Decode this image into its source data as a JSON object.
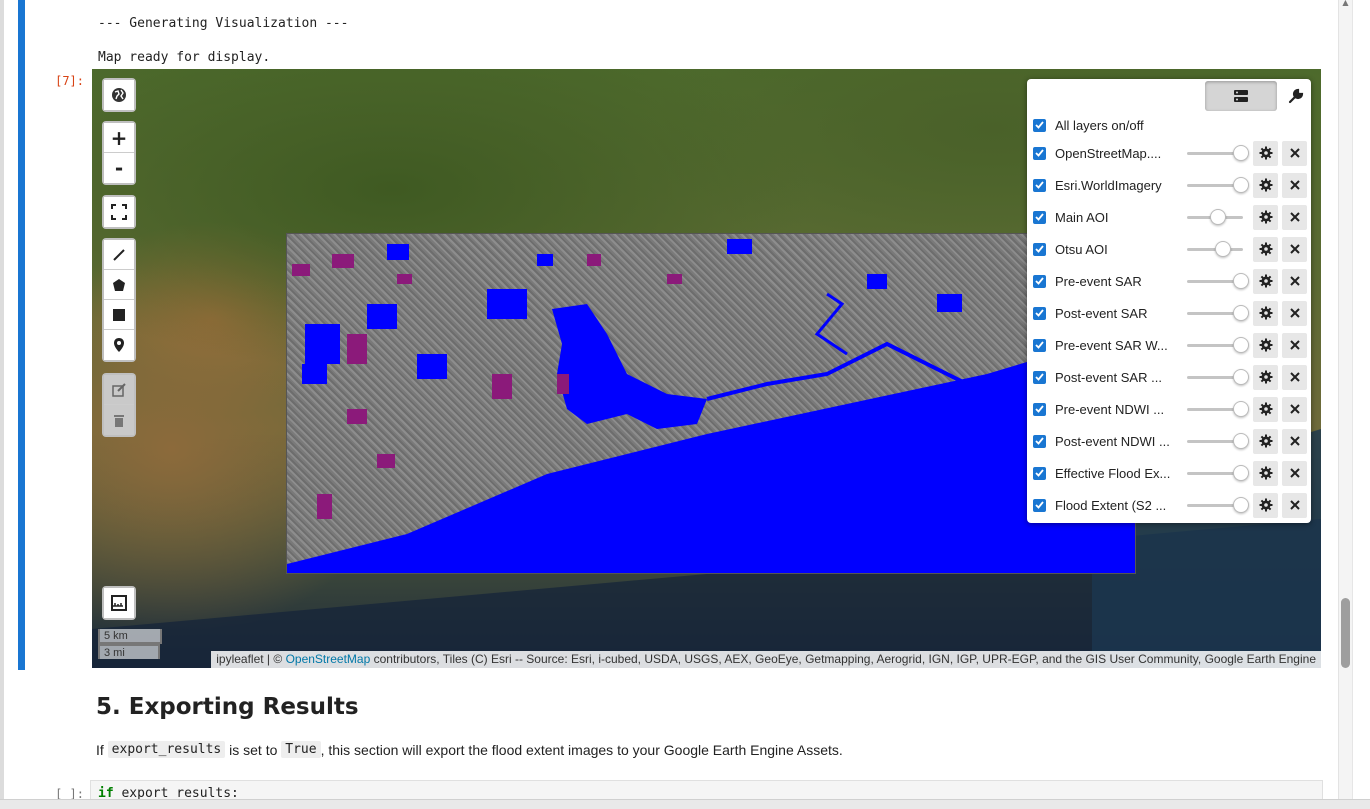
{
  "notebook": {
    "output_line_1": "--- Generating Visualization ---",
    "output_line_2": "Map ready for display.",
    "exec_prompt": "[7]:",
    "empty_prompt": "[ ]:"
  },
  "map": {
    "controls": {
      "zoom_in_label": "+",
      "zoom_out_label": "-"
    },
    "scale": {
      "metric": "5 km",
      "imperial": "3 mi"
    },
    "attribution": {
      "prefix": "ipyleaflet | © ",
      "osm_link": "OpenStreetMap",
      "suffix": " contributors, Tiles (C) Esri -- Source: Esri, i-cubed, USDA, USGS, AEX, GeoEye, Getmapping, Aerogrid, IGN, IGP, UPR-EGP, and the GIS User Community, Google Earth Engine"
    },
    "flood_color": "#0000ff",
    "otsu_color": "#8b1a7a"
  },
  "layers_panel": {
    "all_layers_label": "All layers on/off",
    "layers": [
      {
        "name": "OpenStreetMap....",
        "opacity": 1.0
      },
      {
        "name": "Esri.WorldImagery",
        "opacity": 1.0
      },
      {
        "name": "Main AOI",
        "opacity": 0.5
      },
      {
        "name": "Otsu AOI",
        "opacity": 0.6
      },
      {
        "name": "Pre-event SAR",
        "opacity": 1.0
      },
      {
        "name": "Post-event SAR",
        "opacity": 1.0
      },
      {
        "name": "Pre-event SAR W...",
        "opacity": 1.0
      },
      {
        "name": "Post-event SAR ...",
        "opacity": 1.0
      },
      {
        "name": "Pre-event NDWI ...",
        "opacity": 1.0
      },
      {
        "name": "Post-event NDWI ...",
        "opacity": 1.0
      },
      {
        "name": "Effective Flood Ex...",
        "opacity": 1.0
      },
      {
        "name": "Flood Extent (S2 ...",
        "opacity": 1.0
      }
    ]
  },
  "markdown": {
    "title": "5. Exporting Results",
    "text_1": "If ",
    "code_1": "export_results",
    "text_2": " is set to ",
    "code_2": "True",
    "text_3": ", this section will export the flood extent images to your Google Earth Engine Assets."
  },
  "code": {
    "keyword": "if",
    "rest": " export_results:"
  }
}
